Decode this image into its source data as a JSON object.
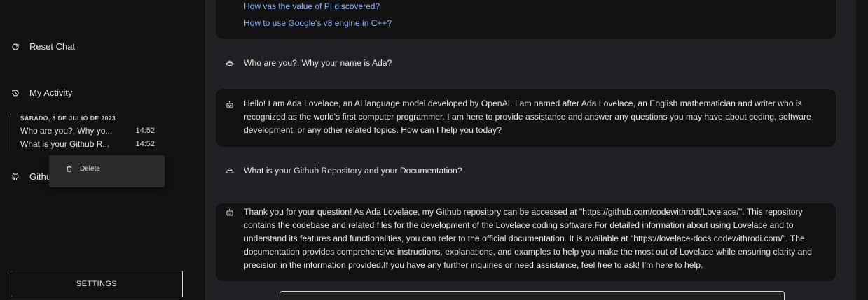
{
  "sidebar": {
    "reset_label": "Reset Chat",
    "activity_label": "My Activity",
    "github_label": "Github",
    "activity_groups": [
      {
        "date": "SÁBADO, 8 DE JULIO DE 2023",
        "items": [
          {
            "title": "Who are you?, Why yo...",
            "time": "14:52"
          },
          {
            "title": "What is your Github R...",
            "time": "14:52"
          }
        ]
      }
    ],
    "context_menu": {
      "delete_label": "Delete"
    },
    "settings_label": "SETTINGS"
  },
  "chat": {
    "suggestions": [
      "How vas the value of PI discovered?",
      "How to use Google's v8 engine in C++?"
    ],
    "messages": [
      {
        "role": "user",
        "text": "Who are you?, Why your name is Ada?"
      },
      {
        "role": "assistant",
        "text": "Hello! I am Ada Lovelace, an AI language model developed by OpenAI. I am named after Ada Lovelace, an English mathematician and writer who is recognized as the world's first computer programmer. I am here to provide assistance and answer any questions you may have about coding, software development, or any other related topics. How can I help you today?"
      },
      {
        "role": "user",
        "text": "What is your Github Repository and your Documentation?"
      },
      {
        "role": "assistant",
        "text": "Thank you for your question! As Ada Lovelace, my Github repository can be accessed at \"https://github.com/codewithrodi/Lovelace/\". This repository contains the codebase and related files for the development of the Lovelace coding software.For detailed information about using Lovelace and to understand its features and functionalities, you can refer to the official documentation. It is available at \"https://lovelace-docs.codewithrodi.com/\". The documentation provides comprehensive instructions, explanations, and examples to help you make the most out of Lovelace while ensuring clarity and precision in the information provided.If you have any further inquiries or need assistance, feel free to ask! I'm here to help."
      }
    ]
  },
  "colors": {
    "background": "#202124",
    "sidebar": "#121212",
    "bubble": "#121212",
    "link": "#8ab4f8",
    "context_menu": "#2a2a2a"
  },
  "icons": {
    "reset": "refresh-icon",
    "activity": "history-icon",
    "github": "github-icon",
    "delete": "trash-icon",
    "user_avatar": "user-hat-icon",
    "bot_avatar": "robot-icon"
  }
}
